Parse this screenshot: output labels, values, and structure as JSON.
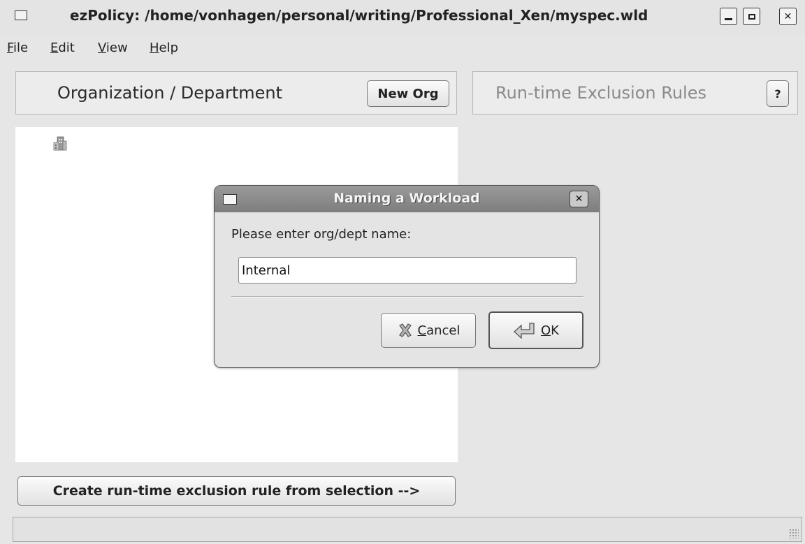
{
  "window": {
    "title": "ezPolicy: /home/vonhagen/personal/writing/Professional_Xen/myspec.wld",
    "minimize_icon": "minimize-icon",
    "maximize_icon": "maximize-icon",
    "close_icon": "close-icon"
  },
  "menubar": {
    "file": "File",
    "edit": "Edit",
    "view": "View",
    "help": "Help"
  },
  "left_panel": {
    "title": "Organization / Department",
    "new_org_button": "New Org",
    "tree_item_icon": "organization-building-icon"
  },
  "right_panel": {
    "title": "Run-time Exclusion Rules",
    "help_button": "?"
  },
  "bottom": {
    "create_rule_button": "Create run-time exclusion rule from selection -->"
  },
  "dialog": {
    "title": "Naming a Workload",
    "prompt": "Please enter org/dept name:",
    "input_value": "Internal",
    "cancel_label": "Cancel",
    "ok_label": "OK",
    "cancel_icon": "cancel-x-icon",
    "ok_icon": "enter-arrow-icon"
  }
}
